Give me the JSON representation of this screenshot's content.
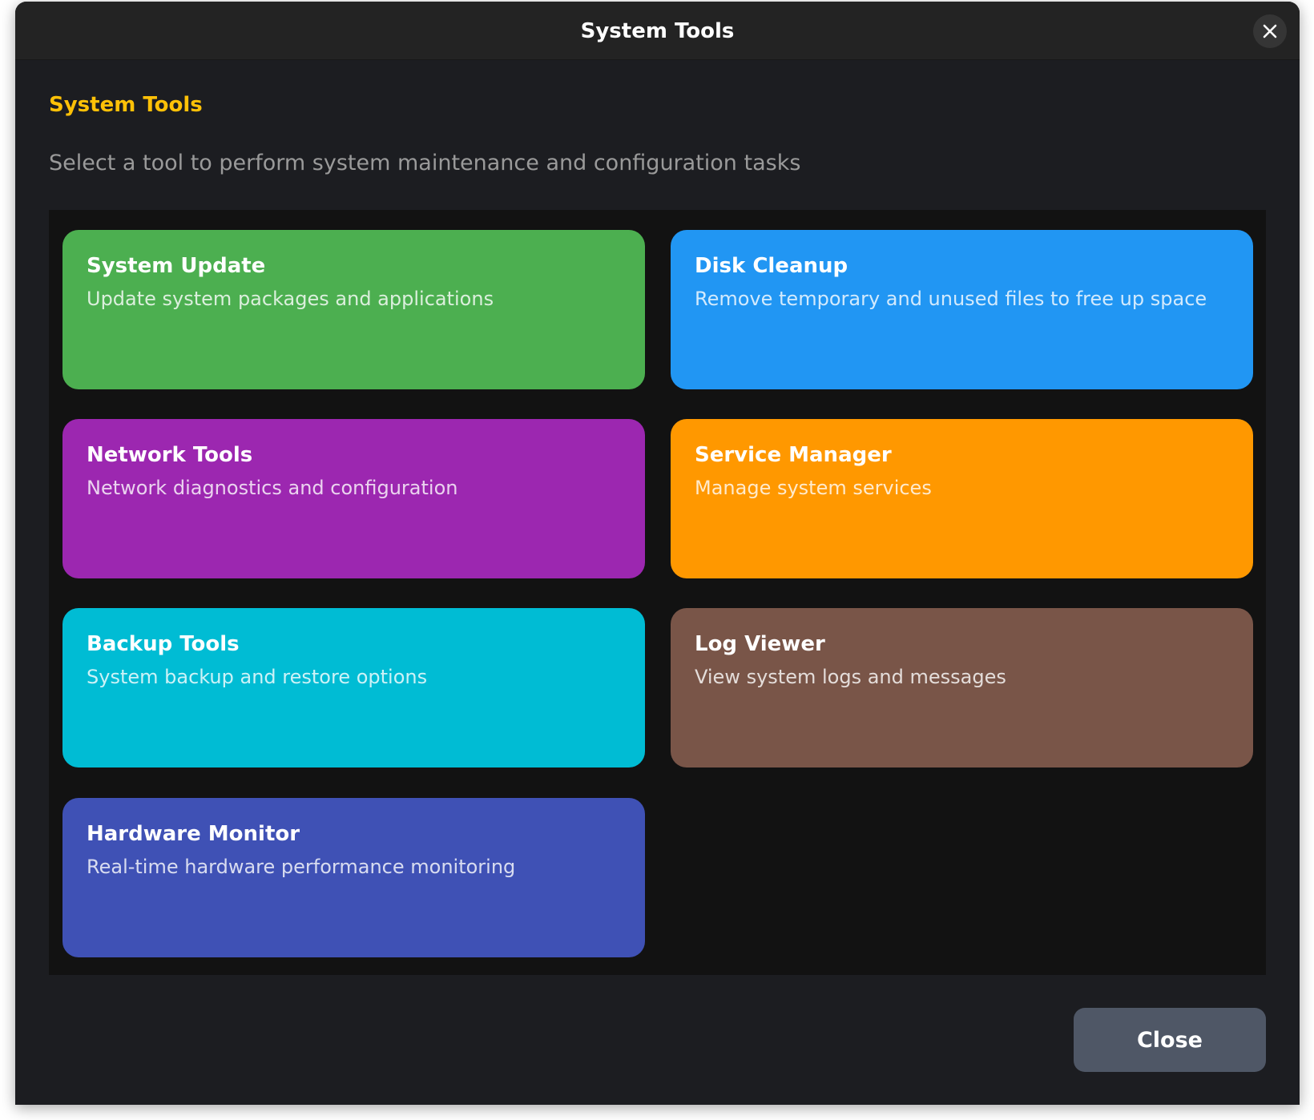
{
  "window": {
    "title": "System Tools"
  },
  "header": {
    "heading": "System Tools",
    "subtitle": "Select a tool to perform system maintenance and configuration tasks"
  },
  "tools": [
    {
      "title": "System Update",
      "description": "Update system packages and applications",
      "color": "#4caf50"
    },
    {
      "title": "Disk Cleanup",
      "description": "Remove temporary and unused files to free up space",
      "color": "#2196f3"
    },
    {
      "title": "Network Tools",
      "description": "Network diagnostics and configuration",
      "color": "#9c27b0"
    },
    {
      "title": "Service Manager",
      "description": "Manage system services",
      "color": "#ff9800"
    },
    {
      "title": "Backup Tools",
      "description": "System backup and restore options",
      "color": "#00bcd4"
    },
    {
      "title": "Log Viewer",
      "description": "View system logs and messages",
      "color": "#795548"
    },
    {
      "title": "Hardware Monitor",
      "description": "Real-time hardware performance monitoring",
      "color": "#3f51b5"
    }
  ],
  "footer": {
    "close_label": "Close"
  }
}
